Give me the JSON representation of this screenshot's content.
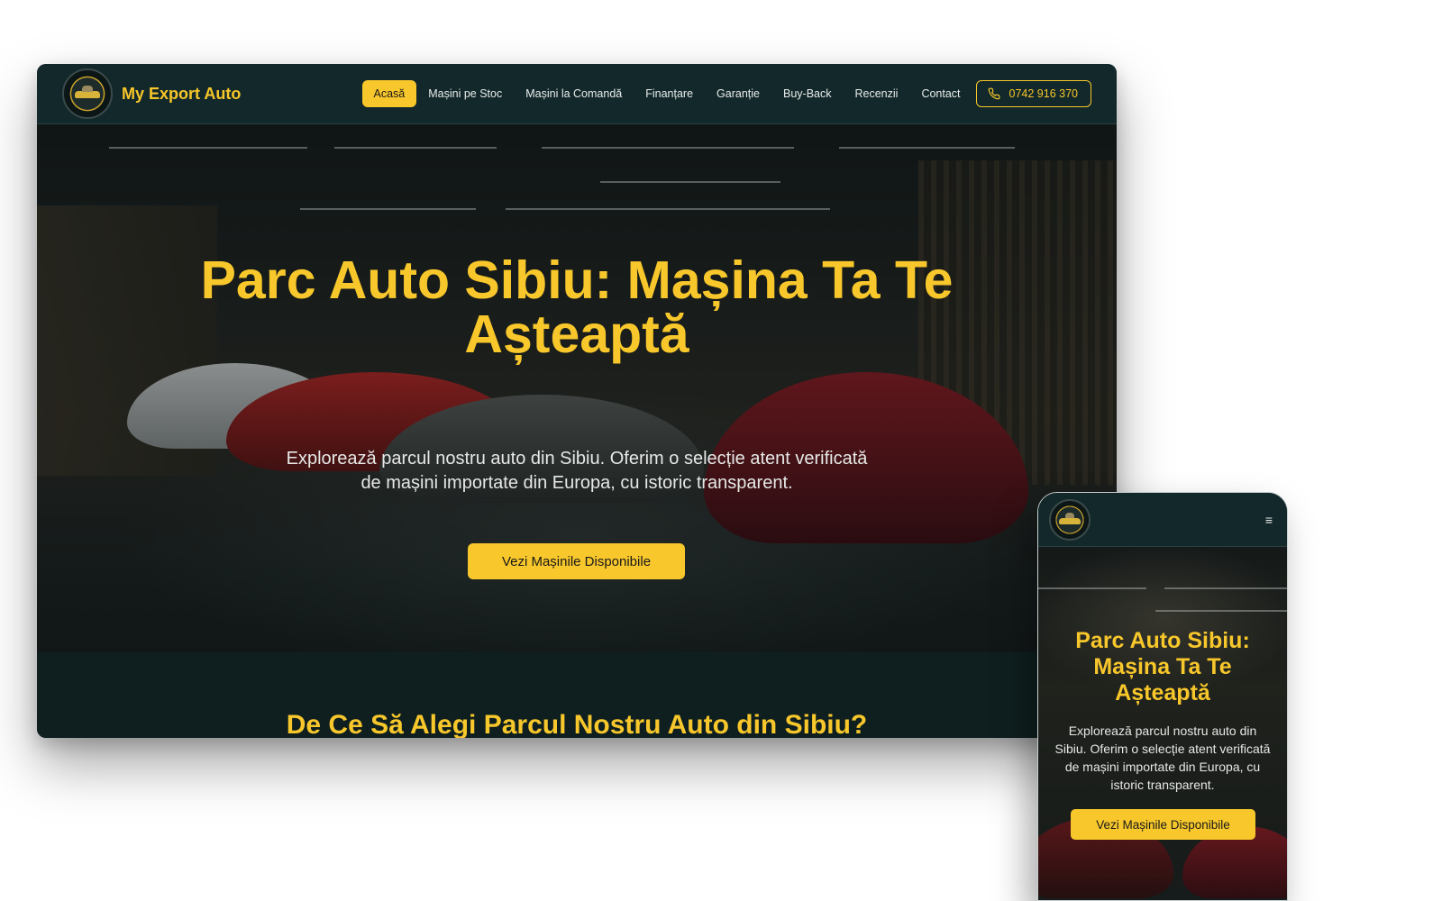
{
  "site": {
    "brand": "My Export Auto",
    "accent_color": "#f7c72b",
    "nav_bg_color": "#13282a"
  },
  "nav": {
    "items": [
      {
        "label": "Acasă",
        "active": true
      },
      {
        "label": "Mașini pe Stoc",
        "active": false
      },
      {
        "label": "Mașini la Comandă",
        "active": false
      },
      {
        "label": "Finanțare",
        "active": false
      },
      {
        "label": "Garanție",
        "active": false
      },
      {
        "label": "Buy-Back",
        "active": false
      },
      {
        "label": "Recenzii",
        "active": false
      },
      {
        "label": "Contact",
        "active": false
      }
    ],
    "phone": "0742 916 370",
    "phone_icon": "phone-icon",
    "menu_icon": "hamburger-icon",
    "menu_glyph": "≡"
  },
  "hero": {
    "title": "Parc Auto Sibiu: Mașina Ta Te Așteaptă",
    "subtitle": "Explorează parcul nostru auto din Sibiu. Oferim o selecție atent verificată de mașini importate din Europa, cu istoric transparent.",
    "cta_label": "Vezi Mașinile Disponibile"
  },
  "section": {
    "title": "De Ce Să Alegi Parcul Nostru Auto din Sibiu?"
  }
}
